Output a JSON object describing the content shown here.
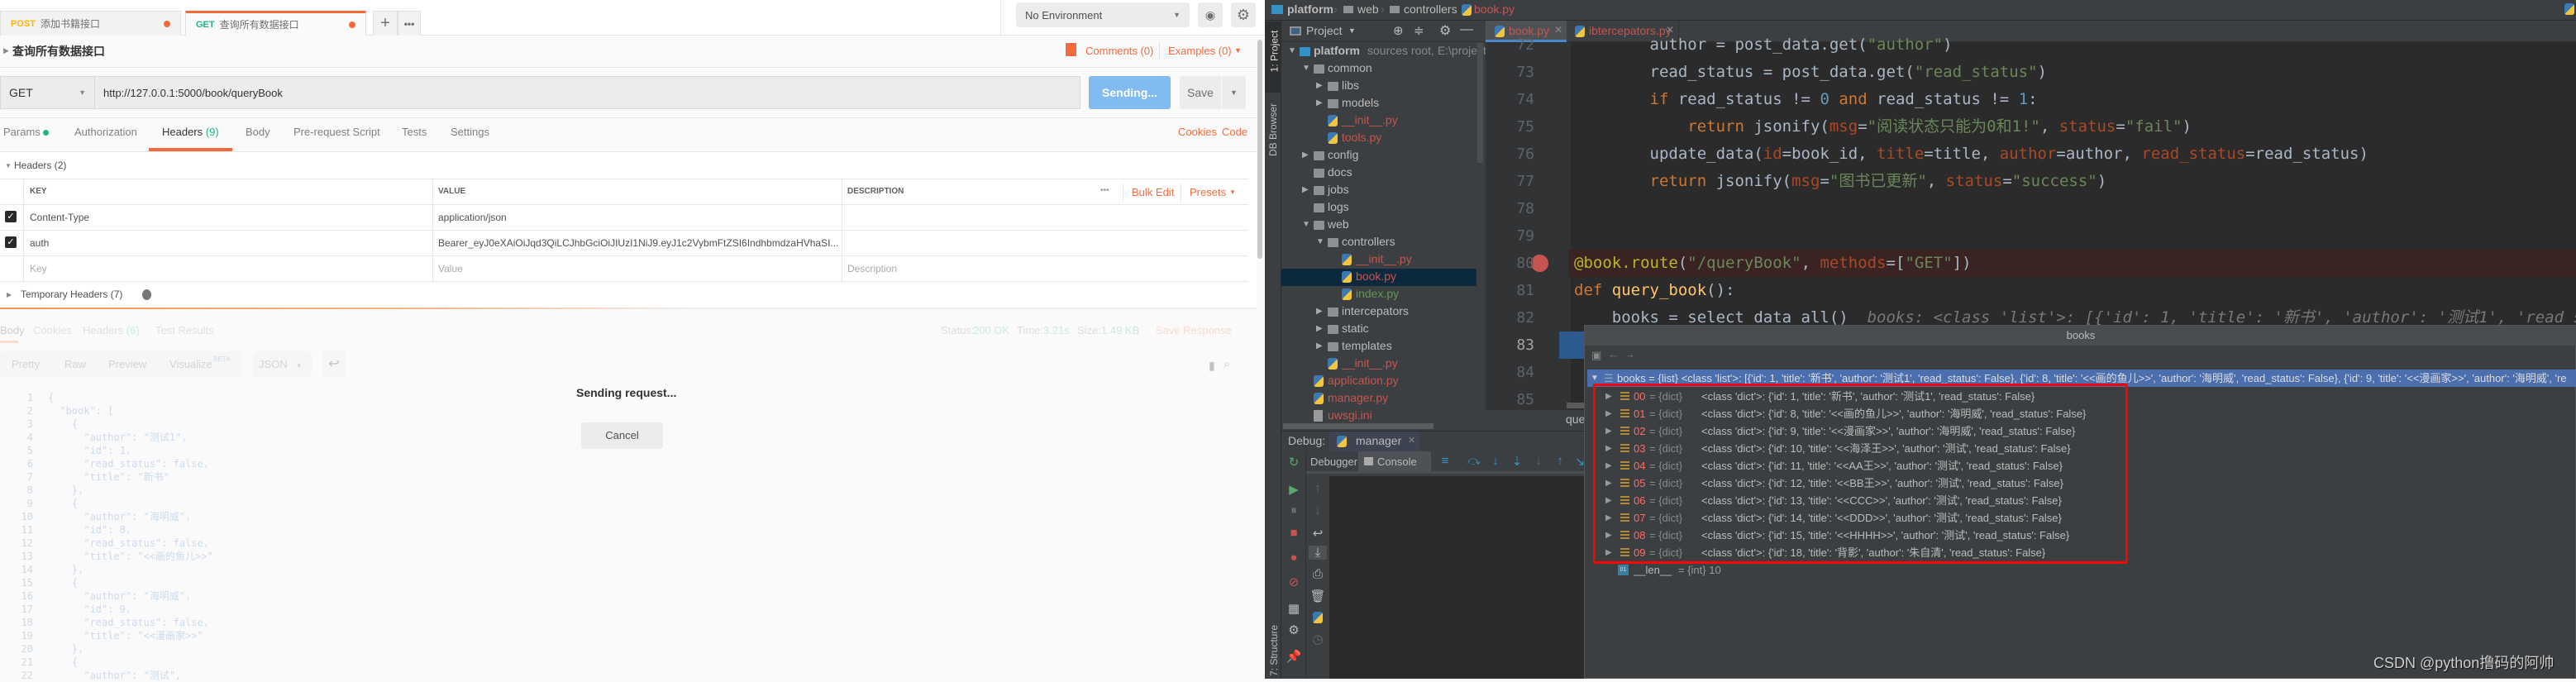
{
  "postman": {
    "tabs": [
      {
        "method": "POST",
        "name": "添加书籍接口",
        "method_color": "#ffb400"
      },
      {
        "method": "GET",
        "name": "查询所有数据接口",
        "method_color": "#26b47f"
      }
    ],
    "environment": "No Environment",
    "request_title": "查询所有数据接口",
    "comments": "Comments (0)",
    "examples": "Examples (0)",
    "method": "GET",
    "url": "http://127.0.0.1:5000/book/queryBook",
    "send_label": "Sending...",
    "save_label": "Save",
    "request_tabs": [
      {
        "label": "Params"
      },
      {
        "label": "Authorization"
      },
      {
        "label": "Headers",
        "count": "(9)"
      },
      {
        "label": "Body"
      },
      {
        "label": "Pre-request Script"
      },
      {
        "label": "Tests"
      },
      {
        "label": "Settings"
      }
    ],
    "active_request_tab": "Headers",
    "cookies": "Cookies",
    "code": "Code",
    "headers_section": "Headers (2)",
    "columns": {
      "key": "KEY",
      "value": "VALUE",
      "description": "DESCRIPTION"
    },
    "bulk_edit": "Bulk Edit",
    "presets": "Presets",
    "headers": [
      {
        "key": "Content-Type",
        "value": "application/json",
        "checked": true
      },
      {
        "key": "auth",
        "value": "Bearer_eyJ0eXAiOiJqd3QiLCJhbGciOiJIUzI1NiJ9.eyJ1c2VybmFtZSI6IndhbmdzaHVhaSI...",
        "checked": true
      }
    ],
    "placeholders": {
      "key": "Key",
      "value": "Value",
      "description": "Description"
    },
    "temporary_headers": "Temporary Headers (7)",
    "response": {
      "tabs": [
        "Body",
        "Cookies",
        "Headers",
        "Test Results"
      ],
      "headers_count": "(6)",
      "status_label": "Status:",
      "status": "200 OK",
      "time_label": "Time:",
      "time": "3.21s",
      "size_label": "Size:",
      "size": "1.49 KB",
      "save_response": "Save Response",
      "views": [
        "Pretty",
        "Raw",
        "Preview",
        "Visualize"
      ],
      "beta": "BETA",
      "format": "JSON",
      "lines": [
        "{",
        "  \"book\": [",
        "    {",
        "      \"author\": \"测试1\",",
        "      \"id\": 1,",
        "      \"read_status\": false,",
        "      \"title\": \"新书\"",
        "    },",
        "    {",
        "      \"author\": \"海明威\",",
        "      \"id\": 8,",
        "      \"read_status\": false,",
        "      \"title\": \"<<画的鱼儿>>\"",
        "    },",
        "    {",
        "      \"author\": \"海明威\",",
        "      \"id\": 9,",
        "      \"read_status\": false,",
        "      \"title\": \"<<漫画家>>\"",
        "    },",
        "    {",
        "      \"author\": \"测试\","
      ]
    },
    "sending_text": "Sending request...",
    "cancel_label": "Cancel",
    "accent": "#f26b3a"
  },
  "pycharm": {
    "breadcrumb": [
      "platform",
      "web",
      "controllers",
      "book.py"
    ],
    "side_tools": [
      "1: Project",
      "DB Browser",
      "7: Structure"
    ],
    "project_label": "Project",
    "tree": [
      {
        "label": "platform",
        "depth": 0,
        "kind": "folder",
        "expanded": true,
        "bold": true,
        "suffix": "sources root,  E:\\project\\p"
      },
      {
        "label": "common",
        "depth": 1,
        "kind": "folder",
        "expanded": true
      },
      {
        "label": "libs",
        "depth": 2,
        "kind": "folder",
        "expanded": false
      },
      {
        "label": "models",
        "depth": 2,
        "kind": "folder",
        "expanded": false
      },
      {
        "label": "__init__.py",
        "depth": 2,
        "kind": "py",
        "status": "modified"
      },
      {
        "label": "tools.py",
        "depth": 2,
        "kind": "py",
        "status": "modified"
      },
      {
        "label": "config",
        "depth": 1,
        "kind": "folder",
        "expanded": false
      },
      {
        "label": "docs",
        "depth": 1,
        "kind": "folder"
      },
      {
        "label": "jobs",
        "depth": 1,
        "kind": "folder",
        "expanded": false
      },
      {
        "label": "logs",
        "depth": 1,
        "kind": "folder"
      },
      {
        "label": "web",
        "depth": 1,
        "kind": "folder",
        "expanded": true
      },
      {
        "label": "controllers",
        "depth": 2,
        "kind": "folder",
        "expanded": true
      },
      {
        "label": "__init__.py",
        "depth": 3,
        "kind": "py",
        "status": "modified"
      },
      {
        "label": "book.py",
        "depth": 3,
        "kind": "py",
        "status": "modified",
        "selected": true
      },
      {
        "label": "index.py",
        "depth": 3,
        "kind": "py",
        "status": "added"
      },
      {
        "label": "intercepators",
        "depth": 2,
        "kind": "folder",
        "expanded": false
      },
      {
        "label": "static",
        "depth": 2,
        "kind": "folder",
        "expanded": false
      },
      {
        "label": "templates",
        "depth": 2,
        "kind": "folder",
        "expanded": false
      },
      {
        "label": "__init__.py",
        "depth": 2,
        "kind": "py",
        "status": "modified"
      },
      {
        "label": "application.py",
        "depth": 1,
        "kind": "py",
        "status": "modified"
      },
      {
        "label": "manager.py",
        "depth": 1,
        "kind": "py",
        "status": "modified"
      },
      {
        "label": "uwsgi.ini",
        "depth": 1,
        "kind": "ini",
        "status": "modified"
      }
    ],
    "status_colors": {
      "modified": "#c75450",
      "added": "#629755"
    },
    "editor_tabs": [
      "book.py",
      "ibtercepators.py"
    ],
    "code": [
      {
        "n": "72",
        "seg": [
          [
            "plain",
            "        author = post_data.get("
          ],
          [
            "str",
            "\"author\""
          ],
          [
            "plain",
            ")"
          ]
        ]
      },
      {
        "n": "73",
        "seg": [
          [
            "plain",
            "        read_status = post_data.get("
          ],
          [
            "str",
            "\"read_status\""
          ],
          [
            "plain",
            ")"
          ]
        ]
      },
      {
        "n": "74",
        "seg": [
          [
            "kw",
            "        if "
          ],
          [
            "plain",
            "read_status != "
          ],
          [
            "num",
            "0"
          ],
          [
            "kw",
            " and "
          ],
          [
            "plain",
            "read_status != "
          ],
          [
            "num",
            "1"
          ],
          [
            "plain",
            ":"
          ]
        ]
      },
      {
        "n": "75",
        "seg": [
          [
            "kw",
            "            return "
          ],
          [
            "plain",
            "jsonify("
          ],
          [
            "param",
            "msg"
          ],
          [
            "plain",
            "="
          ],
          [
            "str",
            "\"阅读状态只能为0和1!\""
          ],
          [
            "plain",
            ", "
          ],
          [
            "param",
            "status"
          ],
          [
            "plain",
            "="
          ],
          [
            "str",
            "\"fail\""
          ],
          [
            "plain",
            ")"
          ]
        ]
      },
      {
        "n": "76",
        "seg": [
          [
            "plain",
            "        update_data("
          ],
          [
            "param",
            "id"
          ],
          [
            "plain",
            "=book_id, "
          ],
          [
            "param",
            "title"
          ],
          [
            "plain",
            "=title, "
          ],
          [
            "param",
            "author"
          ],
          [
            "plain",
            "=author, "
          ],
          [
            "param",
            "read_status"
          ],
          [
            "plain",
            "=read_status)"
          ]
        ]
      },
      {
        "n": "77",
        "seg": [
          [
            "kw",
            "        return "
          ],
          [
            "plain",
            "jsonify("
          ],
          [
            "param",
            "msg"
          ],
          [
            "plain",
            "="
          ],
          [
            "str",
            "\"图书已更新\""
          ],
          [
            "plain",
            ", "
          ],
          [
            "param",
            "status"
          ],
          [
            "plain",
            "="
          ],
          [
            "str",
            "\"success\""
          ],
          [
            "plain",
            ")"
          ]
        ]
      },
      {
        "n": "78",
        "seg": []
      },
      {
        "n": "79",
        "seg": []
      },
      {
        "n": "80",
        "seg": [
          [
            "dec",
            "@book.route"
          ],
          [
            "plain",
            "("
          ],
          [
            "str",
            "\"/queryBook\""
          ],
          [
            "plain",
            ", "
          ],
          [
            "param",
            "methods"
          ],
          [
            "plain",
            "=["
          ],
          [
            "str",
            "\"GET\""
          ],
          [
            "plain",
            "])"
          ]
        ],
        "breakpoint": true
      },
      {
        "n": "81",
        "seg": [
          [
            "kw",
            "def "
          ],
          [
            "fn",
            "query_book"
          ],
          [
            "plain",
            "():"
          ]
        ]
      },
      {
        "n": "82",
        "seg": [
          [
            "plain",
            "    books = select_data_all()  "
          ],
          [
            "hint",
            "books: <class 'list'>: [{'id': 1, 'title': '新书', 'author': '测试1', 'read_stat"
          ]
        ]
      },
      {
        "n": "83",
        "seg": [],
        "current": true
      },
      {
        "n": "84",
        "seg": []
      },
      {
        "n": "85",
        "seg": []
      }
    ],
    "editor_breadcrumb": "que",
    "debug": {
      "label": "Debug:",
      "config": "manager",
      "tabs": [
        "Debugger",
        "Console"
      ],
      "active_tab": "Console"
    },
    "popup": {
      "title": "books",
      "root": "books = {list} <class 'list'>: [{'id': 1, 'title': '新书', 'author': '测试1', 'read_status': False}, {'id': 8, 'title': '<<画的鱼儿>>', 'author': '海明威', 'read_status': False}, {'id': 9, 'title': '<<漫画家>>', 'author': '海明威', 're",
      "items": [
        {
          "idx": "00",
          "type": "= {dict}",
          "value": "<class 'dict'>: {'id': 1, 'title': '新书', 'author': '测试1', 'read_status': False}"
        },
        {
          "idx": "01",
          "type": "= {dict}",
          "value": "<class 'dict'>: {'id': 8, 'title': '<<画的鱼儿>>', 'author': '海明威', 'read_status': False}"
        },
        {
          "idx": "02",
          "type": "= {dict}",
          "value": "<class 'dict'>: {'id': 9, 'title': '<<漫画家>>', 'author': '海明威', 'read_status': False}"
        },
        {
          "idx": "03",
          "type": "= {dict}",
          "value": "<class 'dict'>: {'id': 10, 'title': '<<海泽王>>', 'author': '测试', 'read_status': False}"
        },
        {
          "idx": "04",
          "type": "= {dict}",
          "value": "<class 'dict'>: {'id': 11, 'title': '<<AA王>>', 'author': '测试', 'read_status': False}"
        },
        {
          "idx": "05",
          "type": "= {dict}",
          "value": "<class 'dict'>: {'id': 12, 'title': '<<BB王>>', 'author': '测试', 'read_status': False}"
        },
        {
          "idx": "06",
          "type": "= {dict}",
          "value": "<class 'dict'>: {'id': 13, 'title': '<<CCC>>', 'author': '测试', 'read_status': False}"
        },
        {
          "idx": "07",
          "type": "= {dict}",
          "value": "<class 'dict'>: {'id': 14, 'title': '<<DDD>>', 'author': '测试', 'read_status': False}"
        },
        {
          "idx": "08",
          "type": "= {dict}",
          "value": "<class 'dict'>: {'id': 15, 'title': '<<HHHH>>', 'author': '测试', 'read_status': False}"
        },
        {
          "idx": "09",
          "type": "= {dict}",
          "value": "<class 'dict'>: {'id': 18, 'title': '背影', 'author': '朱自清', 'read_status': False}"
        }
      ],
      "len_name": "__len__",
      "len_value": "= {int} 10",
      "highlight_color": "#ff0000"
    },
    "watermark": "CSDN @python撸码的阿帅"
  }
}
